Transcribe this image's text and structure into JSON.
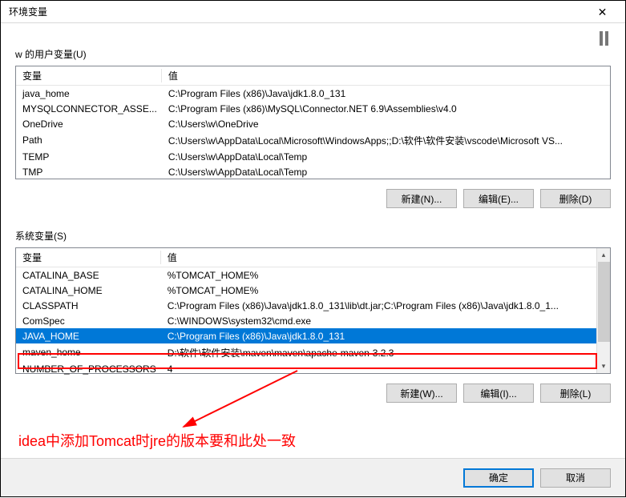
{
  "window": {
    "title": "环境变量"
  },
  "user_section": {
    "label": "w 的用户变量(U)",
    "columns": {
      "name": "变量",
      "value": "值"
    },
    "rows": [
      {
        "name": "java_home",
        "value": "C:\\Program Files (x86)\\Java\\jdk1.8.0_131"
      },
      {
        "name": "MYSQLCONNECTOR_ASSE...",
        "value": "C:\\Program Files (x86)\\MySQL\\Connector.NET 6.9\\Assemblies\\v4.0"
      },
      {
        "name": "OneDrive",
        "value": "C:\\Users\\w\\OneDrive"
      },
      {
        "name": "Path",
        "value": "C:\\Users\\w\\AppData\\Local\\Microsoft\\WindowsApps;;D:\\软件\\软件安装\\vscode\\Microsoft VS..."
      },
      {
        "name": "TEMP",
        "value": "C:\\Users\\w\\AppData\\Local\\Temp"
      },
      {
        "name": "TMP",
        "value": "C:\\Users\\w\\AppData\\Local\\Temp"
      }
    ],
    "buttons": {
      "new": "新建(N)...",
      "edit": "编辑(E)...",
      "delete": "删除(D)"
    }
  },
  "system_section": {
    "label": "系统变量(S)",
    "columns": {
      "name": "变量",
      "value": "值"
    },
    "rows": [
      {
        "name": "CATALINA_BASE",
        "value": "%TOMCAT_HOME%"
      },
      {
        "name": "CATALINA_HOME",
        "value": "%TOMCAT_HOME%"
      },
      {
        "name": "CLASSPATH",
        "value": "C:\\Program Files (x86)\\Java\\jdk1.8.0_131\\lib\\dt.jar;C:\\Program Files (x86)\\Java\\jdk1.8.0_1..."
      },
      {
        "name": "ComSpec",
        "value": "C:\\WINDOWS\\system32\\cmd.exe"
      },
      {
        "name": "JAVA_HOME",
        "value": "C:\\Program Files (x86)\\Java\\jdk1.8.0_131",
        "selected": true
      },
      {
        "name": "maven_home",
        "value": "D:\\软件\\软件安装\\maven\\maven\\apache-maven-3.2.3"
      },
      {
        "name": "NUMBER_OF_PROCESSORS",
        "value": "4"
      }
    ],
    "buttons": {
      "new": "新建(W)...",
      "edit": "编辑(I)...",
      "delete": "删除(L)"
    }
  },
  "dialog_buttons": {
    "ok": "确定",
    "cancel": "取消"
  },
  "annotation": {
    "text": "idea中添加Tomcat时jre的版本要和此处一致"
  }
}
